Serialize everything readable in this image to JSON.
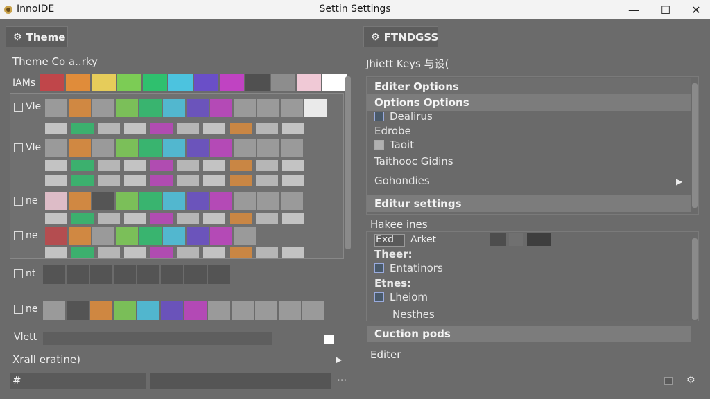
{
  "window": {
    "app_name": "InnoIDE",
    "title": "Settin Settings",
    "minimize": "—",
    "maximize": "☐",
    "close": "✕"
  },
  "left": {
    "tab_label": "Theme",
    "section_title": "Theme Co  a..rky",
    "palette_label": "IAMs",
    "palette": [
      "#c0464a",
      "#e08c3a",
      "#e6cc5a",
      "#7ccc55",
      "#2fc06e",
      "#4cc3df",
      "#6a4fc8",
      "#c043c2",
      "#505050",
      "#8d8d8d",
      "#f0c9d6",
      "#ffffff"
    ],
    "rows": [
      {
        "label": "Vle",
        "checked": false
      },
      {
        "label": "Vle",
        "checked": false
      },
      {
        "label": "ne",
        "checked": false
      },
      {
        "label": "ne",
        "checked": false
      },
      {
        "label": "nt",
        "checked": false
      },
      {
        "label": "ne",
        "checked": false
      },
      {
        "label": "Vlett",
        "checked": false
      }
    ],
    "footer_label": "Xrall eratine)",
    "footer_input": "#",
    "footer_more": "···"
  },
  "right": {
    "tab_label": "FTNDGSS",
    "section_title": "Jhiett Keys 与设(",
    "editor_options": {
      "header": "Editer Options",
      "subheader": "Options Options",
      "items": [
        {
          "label": "Dealirus",
          "type": "checkbox"
        },
        {
          "label": "Edrobe",
          "type": "text"
        },
        {
          "label": "Taoit",
          "type": "checkbox-light"
        },
        {
          "label": "Taithooc Gidins",
          "type": "text"
        },
        {
          "label": "Gohondies",
          "type": "submenu"
        }
      ]
    },
    "editor_settings_header": "Editur settings",
    "hotkeys": {
      "title": "Hakee ines",
      "key_a": "Exd",
      "key_b": "Arket",
      "items": [
        {
          "label": "Theer:",
          "type": "heading"
        },
        {
          "label": "Entatinors",
          "type": "checkbox"
        },
        {
          "label": "Etnes:",
          "type": "heading"
        },
        {
          "label": "Lheiom",
          "type": "checkbox"
        },
        {
          "label": "Nesthes",
          "type": "text"
        }
      ]
    },
    "caution_header": "Cuction pods",
    "footer_label": "Editer"
  },
  "colors": {
    "background": "#6b6b6b",
    "titlebar": "#f3f3f3",
    "header_bar": "#7c7c7c"
  }
}
